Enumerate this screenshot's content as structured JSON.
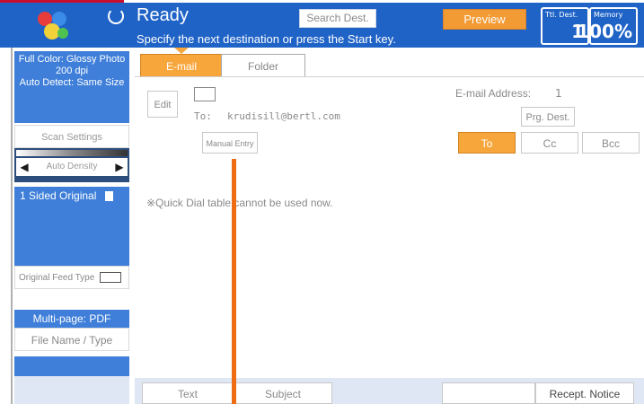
{
  "header": {
    "status": "Ready",
    "message": "Specify the next destination or press the Start key.",
    "search_dest_label": "Search Dest.",
    "preview_label": "Preview",
    "ttl_dest": {
      "label": "Ttl. Dest.",
      "value": "1"
    },
    "memory": {
      "label": "Memory",
      "value": "100%"
    }
  },
  "left_panel": {
    "full_color": [
      "Full Color: Glossy Photo",
      "200 dpi",
      "Auto Detect: Same Size"
    ],
    "scan_settings_label": "Scan Settings",
    "density_label": "Auto Density",
    "sided_original_label": "1 Sided Original",
    "feed_type_label": "Original Feed Type",
    "multipage_label": "Multi-page: PDF",
    "file_name_label": "File Name / Type"
  },
  "tabs": [
    {
      "label": "E-mail"
    },
    {
      "label": "Folder"
    }
  ],
  "main": {
    "edit_label": "Edit",
    "to_label": "To:",
    "to_value": "krudisill@bertl.com",
    "email_address_label": "E-mail Address:",
    "email_address_count": "1",
    "prg_dest_label": "Prg. Dest.",
    "manual_entry_label": "Manual Entry",
    "to_button_label": "To",
    "cc_button_label": "Cc",
    "bcc_button_label": "Bcc",
    "notice": "※Quick Dial table cannot be used now."
  },
  "bottom": {
    "text_label": "Text",
    "subject_label": "Subject",
    "recept_notice_label": "Recept. Notice"
  },
  "colors": {
    "header_blue": "#1f63c7",
    "panel_blue": "#3f7fd9",
    "accent_orange": "#f7a63c",
    "pointer_orange": "#ee6d14"
  },
  "icons": {
    "logo": "color-balls-logo",
    "ready": "circular-arrow-icon",
    "envelope": "envelope-icon",
    "sided": "document-icon",
    "feed_type": "feed-type-icon"
  }
}
